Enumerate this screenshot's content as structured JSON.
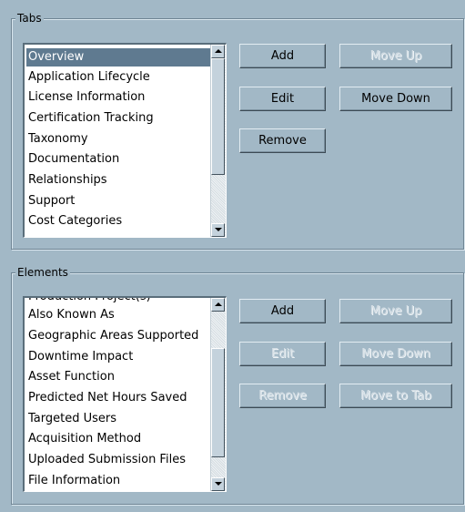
{
  "tabs_group": {
    "title": "Tabs",
    "items": [
      "Overview",
      "Application Lifecycle",
      "License Information",
      "Certification Tracking",
      "Taxonomy",
      "Documentation",
      "Relationships",
      "Support",
      "Cost Categories"
    ],
    "selected_index": 0,
    "buttons": {
      "add": "Add",
      "edit": "Edit",
      "remove": "Remove",
      "move_up": "Move Up",
      "move_down": "Move Down"
    }
  },
  "elements_group": {
    "title": "Elements",
    "partial_item": "Production Project(s)",
    "items": [
      "Also Known As",
      "Geographic Areas Supported",
      "Downtime Impact",
      "Asset Function",
      "Predicted Net Hours Saved",
      "Targeted Users",
      "Acquisition Method",
      "Uploaded Submission Files",
      "File Information"
    ],
    "buttons": {
      "add": "Add",
      "edit": "Edit",
      "remove": "Remove",
      "move_up": "Move Up",
      "move_down": "Move Down",
      "move_to_tab": "Move to Tab"
    }
  },
  "colors": {
    "background": "#a2b8c6",
    "selection": "#5f7a90"
  }
}
